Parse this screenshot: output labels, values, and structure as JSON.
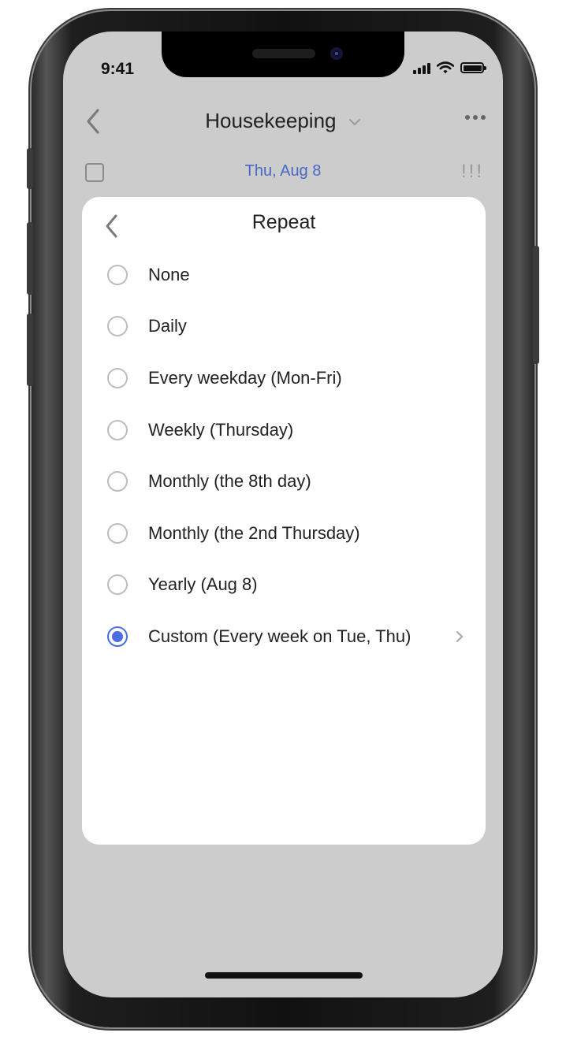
{
  "status_bar": {
    "time": "9:41"
  },
  "header": {
    "title": "Housekeeping"
  },
  "task": {
    "date": "Thu, Aug 8",
    "priority": "!!!"
  },
  "sheet": {
    "title": "Repeat",
    "options": [
      {
        "label": "None",
        "selected": false
      },
      {
        "label": "Daily",
        "selected": false
      },
      {
        "label": "Every weekday (Mon-Fri)",
        "selected": false
      },
      {
        "label": "Weekly (Thursday)",
        "selected": false
      },
      {
        "label": "Monthly (the 8th day)",
        "selected": false
      },
      {
        "label": "Monthly (the 2nd Thursday)",
        "selected": false
      },
      {
        "label": "Yearly (Aug 8)",
        "selected": false
      },
      {
        "label": "Custom (Every week on Tue, Thu)",
        "selected": true
      }
    ]
  },
  "colors": {
    "accent": "#4a6fe0",
    "date": "#4a67c8",
    "backdrop": "#cccccc"
  }
}
